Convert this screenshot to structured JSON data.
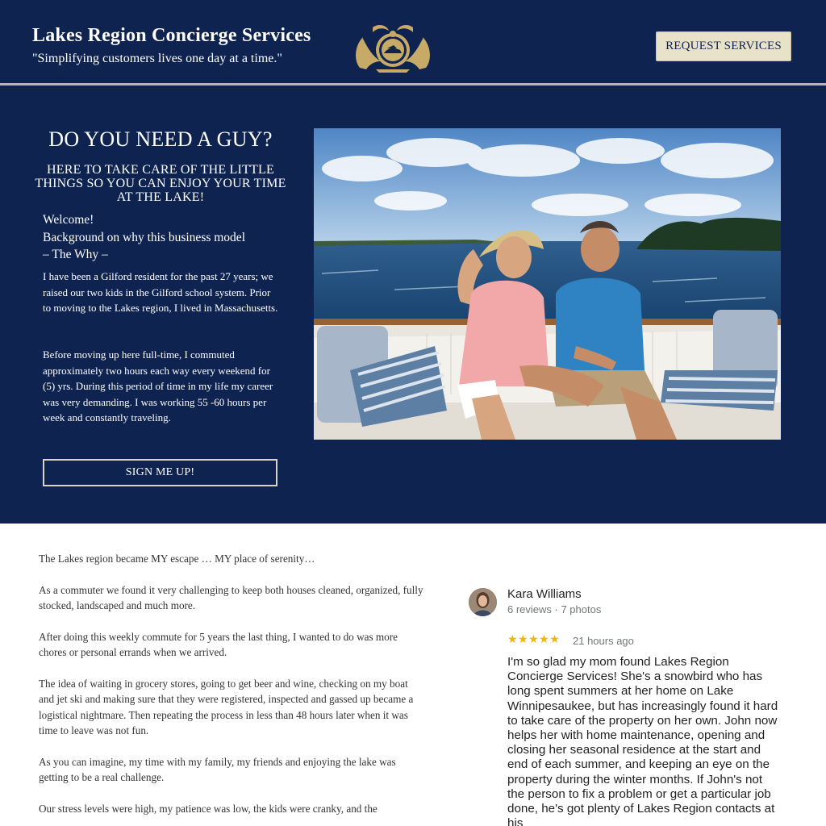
{
  "header": {
    "title": "Lakes Region Concierge Services",
    "tagline": "\"Simplifying customers lives one day at a time.\"",
    "cta_label": "REQUEST SERVICES"
  },
  "hero": {
    "heading": "DO YOU NEED A GUY?",
    "subheading": "HERE TO TAKE CARE OF THE LITTLE THINGS SO YOU CAN ENJOY YOUR TIME AT THE LAKE!",
    "welcome": "Welcome!",
    "background_line": "Background on why this business model",
    "the_why": "– The Why –",
    "paragraph_1": "I have been a Gilford resident for the past 27 years; we raised our two kids in the Gilford school system. Prior to moving to the Lakes region, I lived in Massachusetts.",
    "paragraph_2": "Before moving up here full-time, I commuted approximately two hours each way every weekend for (5) yrs. During this period of time in my life my career was very demanding. I was working 55 -60 hours per week and constantly traveling.",
    "signup_label": "SIGN ME UP!",
    "photo_icon": "couple-on-boat-photo"
  },
  "story": {
    "paragraphs": [
      "The Lakes region became MY escape … MY place of serenity…",
      "As a commuter we found it very challenging to keep both houses cleaned, organized, fully stocked, landscaped and much more.",
      "After doing this weekly commute for 5 years the last thing, I wanted to do was more chores or personal errands when we arrived.",
      "The idea of waiting in grocery stores, going to get beer and wine, checking on my boat and jet ski and making sure that they were registered, inspected and gassed up became a logistical nightmare. Then repeating the process in less than 48 hours later when it was time to leave was not fun.",
      "As you can imagine, my time with my family, my friends and enjoying the lake was getting to be  a real challenge.",
      "Our stress levels were high, my patience was low, the kids were cranky, and the"
    ]
  },
  "review": {
    "name": "Kara Williams",
    "meta": "6 reviews · 7 photos",
    "stars": "★★★★★",
    "rating": 5,
    "time": "21 hours ago",
    "text": "I'm so glad my mom found Lakes Region Concierge Services! She's a snowbird who has long spent summers at her home on Lake Winnipesaukee, but has increasingly found it hard to take care of the property on her own. John now helps her with home maintenance, opening and closing her seasonal residence at the start and end of each summer, and keeping an eye on the property during the winter months. If John's not the person to fix a problem or get a particular job done, he's got plenty of Lakes Region contacts at his"
  },
  "colors": {
    "navy": "#0f2351",
    "cream": "#e8e2c9",
    "gold": "#c8aa68",
    "star": "#f4b400"
  }
}
